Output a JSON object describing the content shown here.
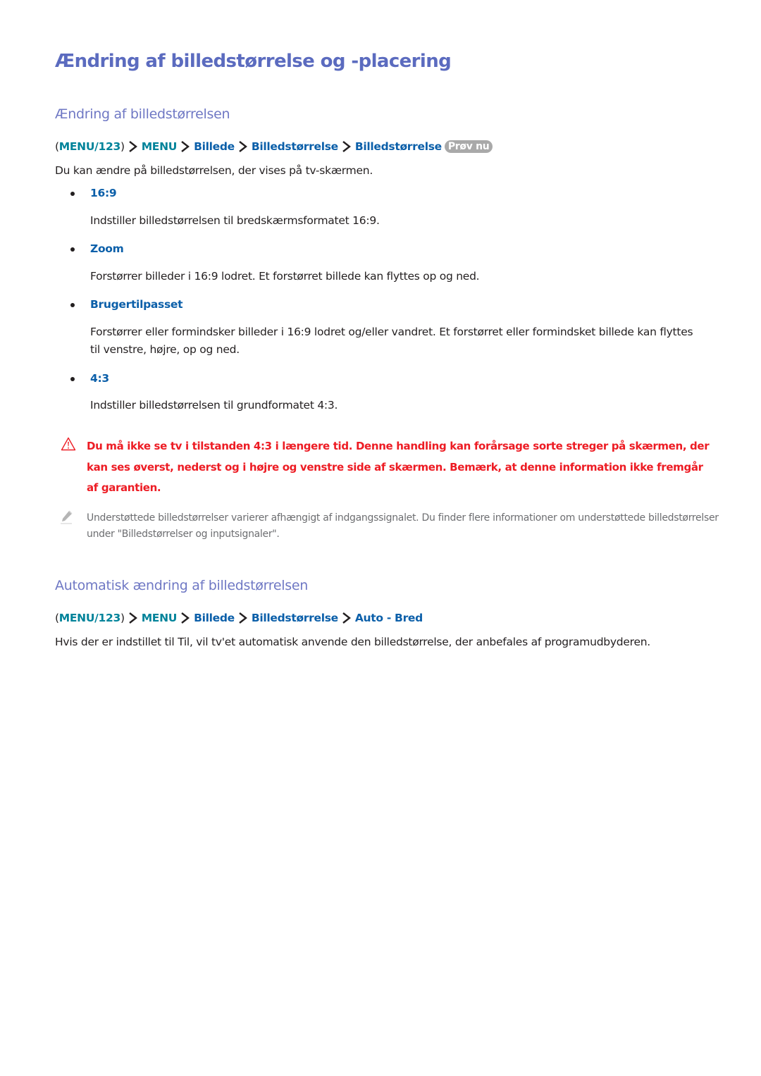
{
  "heading": "Ændring af billedstørrelse og -placering",
  "section1": {
    "title": "Ændring af billedstørrelsen",
    "path": {
      "root": "MENU/123",
      "items": [
        "MENU",
        "Billede",
        "Billedstørrelse",
        "Billedstørrelse"
      ],
      "badge": "Prøv nu"
    },
    "intro": "Du kan ændre på billedstørrelsen, der vises på tv-skærmen.",
    "options": [
      {
        "label": "16:9",
        "description": "Indstiller billedstørrelsen til bredskærmsformatet 16:9."
      },
      {
        "label": "Zoom",
        "description": "Forstørrer billeder i 16:9 lodret. Et forstørret billede kan flyttes op og ned."
      },
      {
        "label": "Brugertilpasset",
        "description": "Forstørrer eller formindsker billeder i 16:9 lodret og/eller vandret. Et forstørret eller formindsket billede kan flyttes til venstre, højre, op og ned."
      },
      {
        "label": "4:3",
        "description": "Indstiller billedstørrelsen til grundformatet 4:3."
      }
    ],
    "warning": {
      "icon": "warning-triangle-icon",
      "text": "Du må ikke se tv i tilstanden 4:3 i længere tid. Denne handling kan forårsage sorte streger på skærmen, der kan ses øverst, nederst og i højre og venstre side af skærmen. Bemærk, at denne information ikke fremgår af garantien."
    },
    "note": {
      "icon": "pencil-icon",
      "text": "Understøttede billedstørrelser varierer afhængigt af indgangssignalet. Du finder flere informationer om understøttede billedstørrelser under \"Billedstørrelser og inputsignaler\"."
    }
  },
  "section2": {
    "title": "Automatisk ændring af billedstørrelsen",
    "path": {
      "root": "MENU/123",
      "items": [
        "MENU",
        "Billede",
        "Billedstørrelse",
        "Auto - Bred"
      ]
    },
    "body": "Hvis der er indstillet til Til, vil tv'et automatisk anvende den billedstørrelse, der anbefales af programudbyderen."
  },
  "colors": {
    "heading": "#5b6bbf",
    "subheading": "#6f78c4",
    "menu_teal": "#00839a",
    "menu_blue": "#0b5fa9",
    "warning_red": "#ed1c24",
    "note_gray": "#6d6e71",
    "badge_gray": "#a9a9a9"
  }
}
